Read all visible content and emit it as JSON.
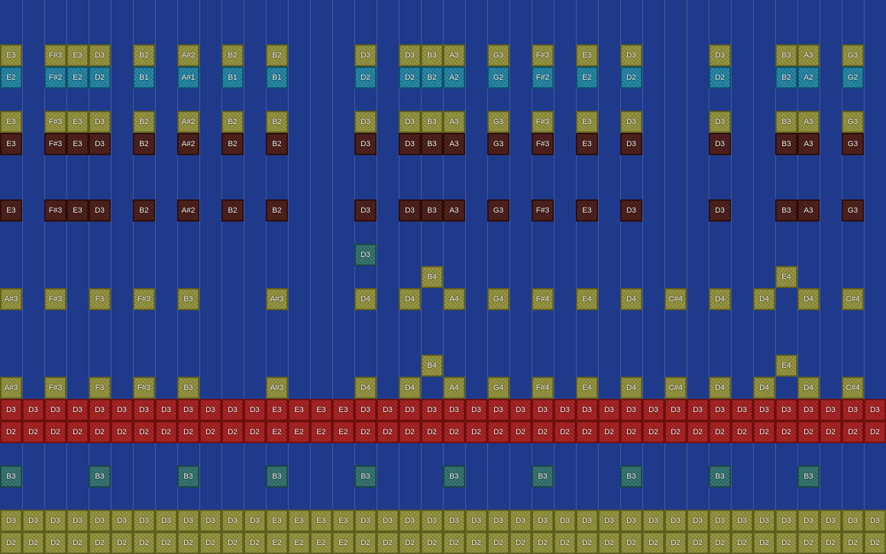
{
  "palette": {
    "background": "#1f3a8a",
    "yellow": "#8d8c37",
    "cyan": "#1b7f9f",
    "brown": "#4a1c18",
    "red": "#a51c1c",
    "teal": "#2f6d6a"
  },
  "rows": [
    {
      "type": "yellow",
      "cells": [
        "E3",
        "",
        "F#3",
        "E3",
        "D3",
        "",
        "B2",
        "",
        "A#2",
        "",
        "B2",
        "",
        "B2",
        "",
        "",
        "",
        "D3",
        "",
        "D3",
        "B3",
        "A3",
        "",
        "G3",
        "",
        "F#3",
        "",
        "E3",
        "",
        "D3",
        "",
        "",
        "",
        "D3",
        "",
        "",
        "B3",
        "A3",
        "",
        "G3",
        ""
      ]
    },
    {
      "type": "cyan",
      "cells": [
        "E2",
        "",
        "F#2",
        "E2",
        "D2",
        "",
        "B1",
        "",
        "A#1",
        "",
        "B1",
        "",
        "B1",
        "",
        "",
        "",
        "D2",
        "",
        "D2",
        "B2",
        "A2",
        "",
        "G2",
        "",
        "F#2",
        "",
        "E2",
        "",
        "D2",
        "",
        "",
        "",
        "D2",
        "",
        "",
        "B2",
        "A2",
        "",
        "G2",
        ""
      ]
    },
    {
      "type": "yellow",
      "cells": []
    },
    {
      "type": "yellow",
      "cells": [
        "E3",
        "",
        "F#3",
        "E3",
        "D3",
        "",
        "B2",
        "",
        "A#2",
        "",
        "B2",
        "",
        "B2",
        "",
        "",
        "",
        "D3",
        "",
        "D3",
        "B3",
        "A3",
        "",
        "G3",
        "",
        "F#3",
        "",
        "E3",
        "",
        "D3",
        "",
        "",
        "",
        "D3",
        "",
        "",
        "B3",
        "A3",
        "",
        "G3",
        ""
      ]
    },
    {
      "type": "brown",
      "cells": [
        "E3",
        "",
        "F#3",
        "E3",
        "D3",
        "",
        "B2",
        "",
        "A#2",
        "",
        "B2",
        "",
        "B2",
        "",
        "",
        "",
        "D3",
        "",
        "D3",
        "B3",
        "A3",
        "",
        "G3",
        "",
        "F#3",
        "",
        "E3",
        "",
        "D3",
        "",
        "",
        "",
        "D3",
        "",
        "",
        "B3",
        "A3",
        "",
        "G3",
        ""
      ]
    },
    {
      "type": "brown",
      "cells": []
    },
    {
      "type": "brown",
      "cells": []
    },
    {
      "type": "brown",
      "cells": [
        "E3",
        "",
        "F#3",
        "E3",
        "D3",
        "",
        "B2",
        "",
        "A#2",
        "",
        "B2",
        "",
        "B2",
        "",
        "",
        "",
        "D3",
        "",
        "D3",
        "B3",
        "A3",
        "",
        "G3",
        "",
        "F#3",
        "",
        "E3",
        "",
        "D3",
        "",
        "",
        "",
        "D3",
        "",
        "",
        "B3",
        "A3",
        "",
        "G3",
        ""
      ]
    },
    {
      "type": "brown",
      "cells": []
    },
    {
      "type": "teal",
      "cells": [
        "",
        "",
        "",
        "",
        "",
        "",
        "",
        "",
        "",
        "",
        "",
        "",
        "",
        "",
        "",
        "",
        "D3",
        "",
        "",
        "",
        "",
        "",
        "",
        "",
        "",
        "",
        "",
        "",
        "",
        "",
        "",
        "",
        "",
        "",
        "",
        "",
        "",
        "",
        "",
        ""
      ]
    },
    {
      "type": "yellow",
      "cells": [
        "",
        "",
        "",
        "",
        "",
        "",
        "",
        "",
        "",
        "",
        "",
        "",
        "",
        "",
        "",
        "",
        "",
        "",
        "",
        "B4",
        "",
        "",
        "",
        "",
        "",
        "",
        "",
        "",
        "",
        "",
        "",
        "",
        "",
        "",
        "",
        "E4",
        "",
        "",
        "",
        ""
      ]
    },
    {
      "type": "yellow",
      "cells": [
        "A#3",
        "",
        "F#3",
        "",
        "F3",
        "",
        "F#3",
        "",
        "B3",
        "",
        "",
        "",
        "A#3",
        "",
        "",
        "",
        "D4",
        "",
        "D4",
        "",
        "A4",
        "",
        "G4",
        "",
        "F#4",
        "",
        "E4",
        "",
        "D4",
        "",
        "C#4",
        "",
        "D4",
        "",
        "D4",
        "",
        "D4",
        "",
        "C#4",
        ""
      ]
    },
    {
      "type": "yellow",
      "cells": []
    },
    {
      "type": "yellow",
      "cells": []
    },
    {
      "type": "yellow",
      "cells": [
        "",
        "",
        "",
        "",
        "",
        "",
        "",
        "",
        "",
        "",
        "",
        "",
        "",
        "",
        "",
        "",
        "",
        "",
        "",
        "B4",
        "",
        "",
        "",
        "",
        "",
        "",
        "",
        "",
        "",
        "",
        "",
        "",
        "",
        "",
        "",
        "E4",
        "",
        "",
        "",
        ""
      ]
    },
    {
      "type": "yellow",
      "cells": [
        "A#3",
        "",
        "F#3",
        "",
        "F3",
        "",
        "F#3",
        "",
        "B3",
        "",
        "",
        "",
        "A#3",
        "",
        "",
        "",
        "D4",
        "",
        "D4",
        "",
        "A4",
        "",
        "G4",
        "",
        "F#4",
        "",
        "E4",
        "",
        "D4",
        "",
        "C#4",
        "",
        "D4",
        "",
        "D4",
        "",
        "D4",
        "",
        "C#4",
        ""
      ]
    },
    {
      "type": "red",
      "cells": [
        "D3",
        "D3",
        "D3",
        "D3",
        "D3",
        "D3",
        "D3",
        "D3",
        "D3",
        "D3",
        "D3",
        "D3",
        "E3",
        "E3",
        "E3",
        "E3",
        "D3",
        "D3",
        "D3",
        "D3",
        "D3",
        "D3",
        "D3",
        "D3",
        "D3",
        "D3",
        "D3",
        "D3",
        "D3",
        "D3",
        "D3",
        "D3",
        "D3",
        "D3",
        "D3",
        "D3",
        "D3",
        "D3",
        "D3",
        "D3"
      ]
    },
    {
      "type": "red",
      "cells": [
        "D2",
        "D2",
        "D2",
        "D2",
        "D2",
        "D2",
        "D2",
        "D2",
        "D2",
        "D2",
        "D2",
        "D2",
        "E2",
        "E2",
        "E2",
        "E2",
        "D2",
        "D2",
        "D2",
        "D2",
        "D2",
        "D2",
        "D2",
        "D2",
        "D2",
        "D2",
        "D2",
        "D2",
        "D2",
        "D2",
        "D2",
        "D2",
        "D2",
        "D2",
        "D2",
        "D2",
        "D2",
        "D2",
        "D2",
        "D2"
      ]
    },
    {
      "type": "teal",
      "cells": []
    },
    {
      "type": "teal",
      "cells": [
        "B3",
        "",
        "",
        "",
        "B3",
        "",
        "",
        "",
        "B3",
        "",
        "",
        "",
        "B3",
        "",
        "",
        "",
        "B3",
        "",
        "",
        "",
        "B3",
        "",
        "",
        "",
        "B3",
        "",
        "",
        "",
        "B3",
        "",
        "",
        "",
        "B3",
        "",
        "",
        "",
        "B3",
        "",
        "",
        ""
      ]
    },
    {
      "type": "teal",
      "cells": []
    },
    {
      "type": "yellow",
      "cells": [
        "D3",
        "D3",
        "D3",
        "D3",
        "D3",
        "D3",
        "D3",
        "D3",
        "D3",
        "D3",
        "D3",
        "D3",
        "E3",
        "E3",
        "E3",
        "E3",
        "D3",
        "D3",
        "D3",
        "D3",
        "D3",
        "D3",
        "D3",
        "D3",
        "D3",
        "D3",
        "D3",
        "D3",
        "D3",
        "D3",
        "D3",
        "D3",
        "D3",
        "D3",
        "D3",
        "D3",
        "D3",
        "D3",
        "D3",
        "D3"
      ]
    },
    {
      "type": "yellow",
      "cells": [
        "D2",
        "D2",
        "D2",
        "D2",
        "D2",
        "D2",
        "D2",
        "D2",
        "D2",
        "D2",
        "D2",
        "D2",
        "E2",
        "E2",
        "E2",
        "E2",
        "D2",
        "D2",
        "D2",
        "D2",
        "D2",
        "D2",
        "D2",
        "D2",
        "D2",
        "D2",
        "D2",
        "D2",
        "D2",
        "D2",
        "D2",
        "D2",
        "D2",
        "D2",
        "D2",
        "D2",
        "D2",
        "D2",
        "D2",
        "D2"
      ]
    }
  ]
}
